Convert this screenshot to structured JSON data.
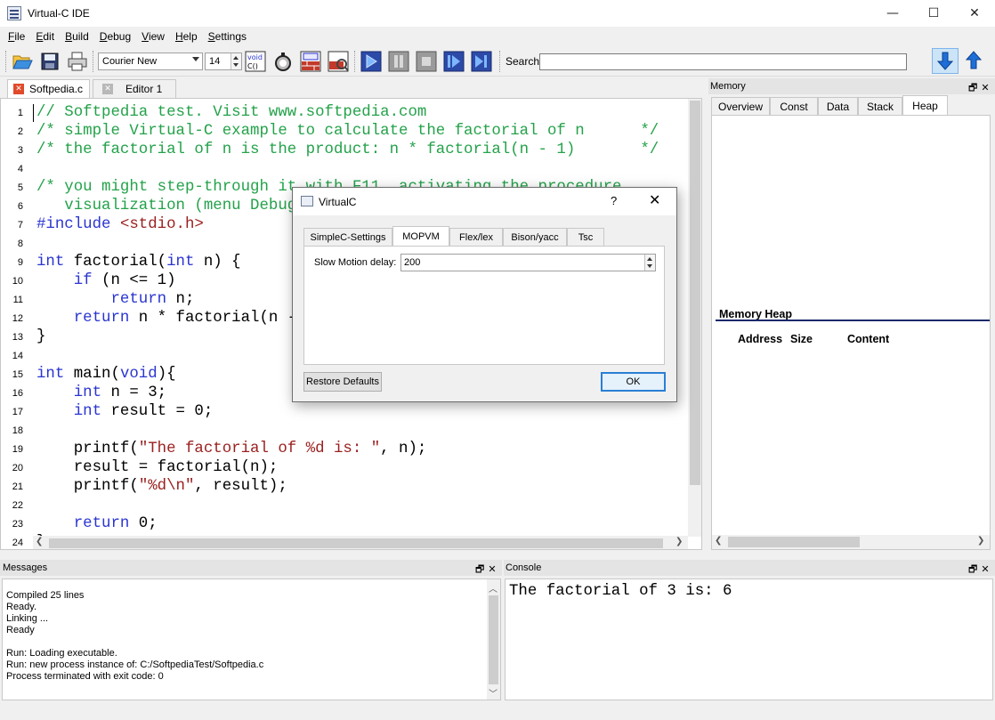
{
  "window": {
    "title": "Virtual-C IDE",
    "minimize": "—",
    "maximize": "☐",
    "close": "✕"
  },
  "menu": [
    "File",
    "Edit",
    "Build",
    "Debug",
    "View",
    "Help",
    "Settings"
  ],
  "toolbar": {
    "font_family_value": "Courier New",
    "font_size_value": "14",
    "void_label": "void",
    "c_label": "C()",
    "search_label": "Search:",
    "search_value": ""
  },
  "editor_tabs": [
    {
      "label": "Softpedia.c",
      "active": true
    },
    {
      "label": "Editor 1",
      "active": false
    }
  ],
  "editor": {
    "line_numbers": [
      "1",
      "2",
      "3",
      "4",
      "5",
      "6",
      "7",
      "8",
      "9",
      "10",
      "11",
      "12",
      "13",
      "14",
      "15",
      "16",
      "17",
      "18",
      "19",
      "20",
      "21",
      "22",
      "23",
      "24"
    ],
    "lines": [
      [
        {
          "t": "// Softpedia test. Visit www.softpedia.com",
          "c": "cm"
        }
      ],
      [
        {
          "t": "/* simple Virtual-C example to calculate the factorial of n      */",
          "c": "cm"
        }
      ],
      [
        {
          "t": "/* the factorial of n is the product: n * factorial(n - 1)       */",
          "c": "cm"
        }
      ],
      [],
      [
        {
          "t": "/* you might step-through it with F11, activating the procedure",
          "c": "cm"
        }
      ],
      [
        {
          "t": "   visualization (menu Debug->Activate Procedure Visualization) */",
          "c": "cm"
        }
      ],
      [
        {
          "t": "#include ",
          "c": "pp"
        },
        {
          "t": "<stdio.h>",
          "c": "str"
        }
      ],
      [],
      [
        {
          "t": "int",
          "c": "kw"
        },
        {
          "t": " factorial(",
          "c": "nm"
        },
        {
          "t": "int",
          "c": "kw"
        },
        {
          "t": " n) {",
          "c": "nm"
        }
      ],
      [
        {
          "t": "    ",
          "c": "nm"
        },
        {
          "t": "if",
          "c": "kw"
        },
        {
          "t": " (n <= 1)",
          "c": "nm"
        }
      ],
      [
        {
          "t": "        ",
          "c": "nm"
        },
        {
          "t": "return",
          "c": "kw"
        },
        {
          "t": " n;",
          "c": "nm"
        }
      ],
      [
        {
          "t": "    ",
          "c": "nm"
        },
        {
          "t": "return",
          "c": "kw"
        },
        {
          "t": " n * factorial(n - 1);",
          "c": "nm"
        }
      ],
      [
        {
          "t": "}",
          "c": "nm"
        }
      ],
      [],
      [
        {
          "t": "int",
          "c": "kw"
        },
        {
          "t": " main(",
          "c": "nm"
        },
        {
          "t": "void",
          "c": "kw"
        },
        {
          "t": "){",
          "c": "nm"
        }
      ],
      [
        {
          "t": "    ",
          "c": "nm"
        },
        {
          "t": "int",
          "c": "kw"
        },
        {
          "t": " n = 3;",
          "c": "nm"
        }
      ],
      [
        {
          "t": "    ",
          "c": "nm"
        },
        {
          "t": "int",
          "c": "kw"
        },
        {
          "t": " result = 0;",
          "c": "nm"
        }
      ],
      [],
      [
        {
          "t": "    printf(",
          "c": "nm"
        },
        {
          "t": "\"The factorial of %d is: \"",
          "c": "str"
        },
        {
          "t": ", n);",
          "c": "nm"
        }
      ],
      [
        {
          "t": "    result = factorial(n);",
          "c": "nm"
        }
      ],
      [
        {
          "t": "    printf(",
          "c": "nm"
        },
        {
          "t": "\"%d\\n\"",
          "c": "str"
        },
        {
          "t": ", result);",
          "c": "nm"
        }
      ],
      [],
      [
        {
          "t": "    ",
          "c": "nm"
        },
        {
          "t": "return",
          "c": "kw"
        },
        {
          "t": " 0;",
          "c": "nm"
        }
      ],
      [
        {
          "t": "}",
          "c": "nm"
        }
      ]
    ]
  },
  "memory": {
    "title": "Memory",
    "tabs": [
      "Overview",
      "Const",
      "Data",
      "Stack",
      "Heap"
    ],
    "active_tab": "Heap",
    "heap_title": "Memory Heap",
    "columns": [
      "Address",
      "Size",
      "Content"
    ]
  },
  "messages": {
    "title": "Messages",
    "lines": [
      "Compiled 25 lines",
      "Ready.",
      "Linking ...",
      "Ready",
      "",
      "Run: Loading executable.",
      "Run: new process instance of: C:/SoftpediaTest/Softpedia.c",
      "Process terminated with exit code: 0"
    ]
  },
  "console": {
    "title": "Console",
    "output": "The factorial of 3 is: 6"
  },
  "dialog": {
    "title": "VirtualC",
    "help": "?",
    "close": "✕",
    "tabs": [
      "SimpleC-Settings",
      "MOPVM",
      "Flex/lex",
      "Bison/yacc",
      "Tsc"
    ],
    "active_tab": "MOPVM",
    "slow_motion_label": "Slow Motion delay:",
    "slow_motion_value": "200",
    "restore_button": "Restore Defaults",
    "ok_button": "OK"
  },
  "colors": {
    "comment": "#24a24a",
    "keyword": "#2a35d0",
    "string": "#9a1f1f",
    "accent": "#2a7fd4"
  },
  "dock_buttons": "🗗✕"
}
